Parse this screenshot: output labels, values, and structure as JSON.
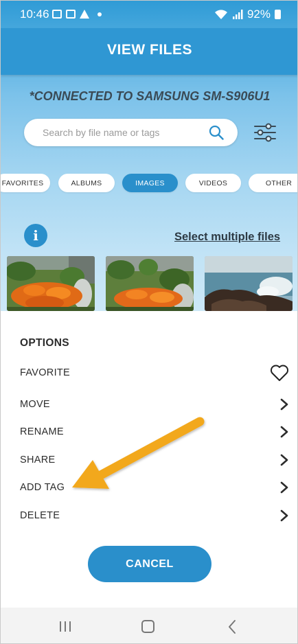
{
  "status_bar": {
    "time": "10:46",
    "battery": "92%"
  },
  "header": {
    "title": "VIEW FILES"
  },
  "connection": {
    "text": "*CONNECTED TO SAMSUNG SM-S906U1"
  },
  "search": {
    "placeholder": "Search by file name or tags"
  },
  "filters": [
    {
      "label": "FAVORITES",
      "active": false
    },
    {
      "label": "ALBUMS",
      "active": false
    },
    {
      "label": "IMAGES",
      "active": true
    },
    {
      "label": "VIDEOS",
      "active": false
    },
    {
      "label": "OTHER",
      "active": false
    }
  ],
  "info": {
    "icon_glyph": "i"
  },
  "select_multiple": {
    "label": "Select multiple files"
  },
  "options": {
    "title": "OPTIONS",
    "items": [
      {
        "label": "FAVORITE",
        "icon": "heart-icon"
      },
      {
        "label": "MOVE",
        "icon": "chevron-right-icon"
      },
      {
        "label": "RENAME",
        "icon": "chevron-right-icon"
      },
      {
        "label": "SHARE",
        "icon": "chevron-right-icon"
      },
      {
        "label": "ADD TAG",
        "icon": "chevron-right-icon"
      },
      {
        "label": "DELETE",
        "icon": "chevron-right-icon"
      }
    ]
  },
  "cancel": {
    "label": "CANCEL"
  },
  "colors": {
    "primary": "#2a8fcb",
    "annotation_arrow": "#f2a81d"
  }
}
